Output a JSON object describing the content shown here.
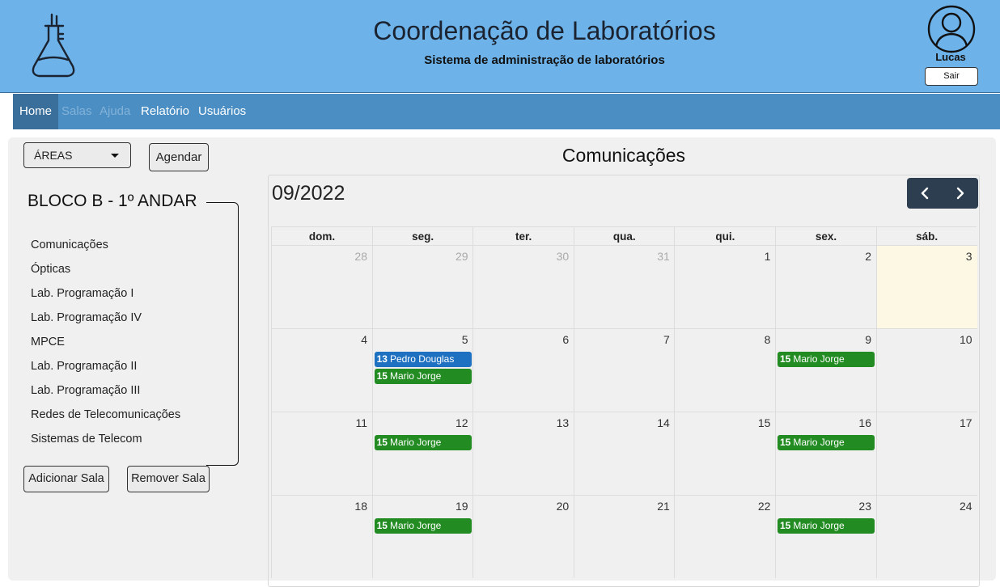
{
  "header": {
    "title": "Coordenação de Laboratórios",
    "subtitle": "Sistema de administração de laboratórios",
    "user_name": "Lucas",
    "logout_label": "Sair"
  },
  "nav": {
    "items": [
      {
        "label": "Home",
        "state": "active"
      },
      {
        "label": "Salas",
        "state": "disabled"
      },
      {
        "label": "Ajuda",
        "state": "disabled"
      },
      {
        "label": "Relatório",
        "state": "enabled"
      },
      {
        "label": "Usuários",
        "state": "enabled"
      }
    ]
  },
  "sidebar": {
    "areas_label": "ÁREAS",
    "schedule_label": "Agendar",
    "block_title": "BLOCO B - 1º ANDAR",
    "rooms": [
      "Comunicações",
      "Ópticas",
      "Lab. Programação I",
      "Lab. Programação IV",
      "MPCE",
      "Lab. Programação II",
      "Lab. Programação III",
      "Redes de Telecomunicações",
      "Sistemas de Telecom"
    ],
    "add_room_label": "Adicionar Sala",
    "remove_room_label": "Remover Sala"
  },
  "calendar": {
    "room_name": "Comunicações",
    "month_label": "09/2022",
    "weekdays": [
      "dom.",
      "seg.",
      "ter.",
      "qua.",
      "qui.",
      "sex.",
      "sáb."
    ],
    "weeks": [
      [
        "28",
        "29",
        "30",
        "31",
        "1",
        "2",
        "3"
      ],
      [
        "4",
        "5",
        "6",
        "7",
        "8",
        "9",
        "10"
      ],
      [
        "11",
        "12",
        "13",
        "14",
        "15",
        "16",
        "17"
      ],
      [
        "18",
        "19",
        "20",
        "21",
        "22",
        "23",
        "24"
      ]
    ],
    "other_month_days": [
      "28",
      "29",
      "30",
      "31"
    ],
    "today": "3",
    "today_color": "#fcf8e3",
    "events": [
      {
        "week": 1,
        "day": 1,
        "hour": "13",
        "name": "Pedro Douglas",
        "color": "#1e70c0"
      },
      {
        "week": 1,
        "day": 1,
        "hour": "15",
        "name": "Mario Jorge",
        "color": "#228b22"
      },
      {
        "week": 1,
        "day": 5,
        "hour": "15",
        "name": "Mario Jorge",
        "color": "#228b22"
      },
      {
        "week": 2,
        "day": 1,
        "hour": "15",
        "name": "Mario Jorge",
        "color": "#228b22"
      },
      {
        "week": 2,
        "day": 5,
        "hour": "15",
        "name": "Mario Jorge",
        "color": "#228b22"
      },
      {
        "week": 3,
        "day": 1,
        "hour": "15",
        "name": "Mario Jorge",
        "color": "#228b22"
      },
      {
        "week": 3,
        "day": 5,
        "hour": "15",
        "name": "Mario Jorge",
        "color": "#228b22"
      }
    ]
  },
  "colors": {
    "header_bg": "#6db3ea",
    "nav_bg": "#4a8ec4",
    "nav_active_bg": "#3a6f9b",
    "calendar_nav_bg": "#2c3e50"
  },
  "icons": {
    "logo": "lab-flask-icon",
    "avatar": "user-avatar-icon",
    "prev": "chevron-left-icon",
    "next": "chevron-right-icon",
    "dropdown": "caret-down-icon"
  }
}
